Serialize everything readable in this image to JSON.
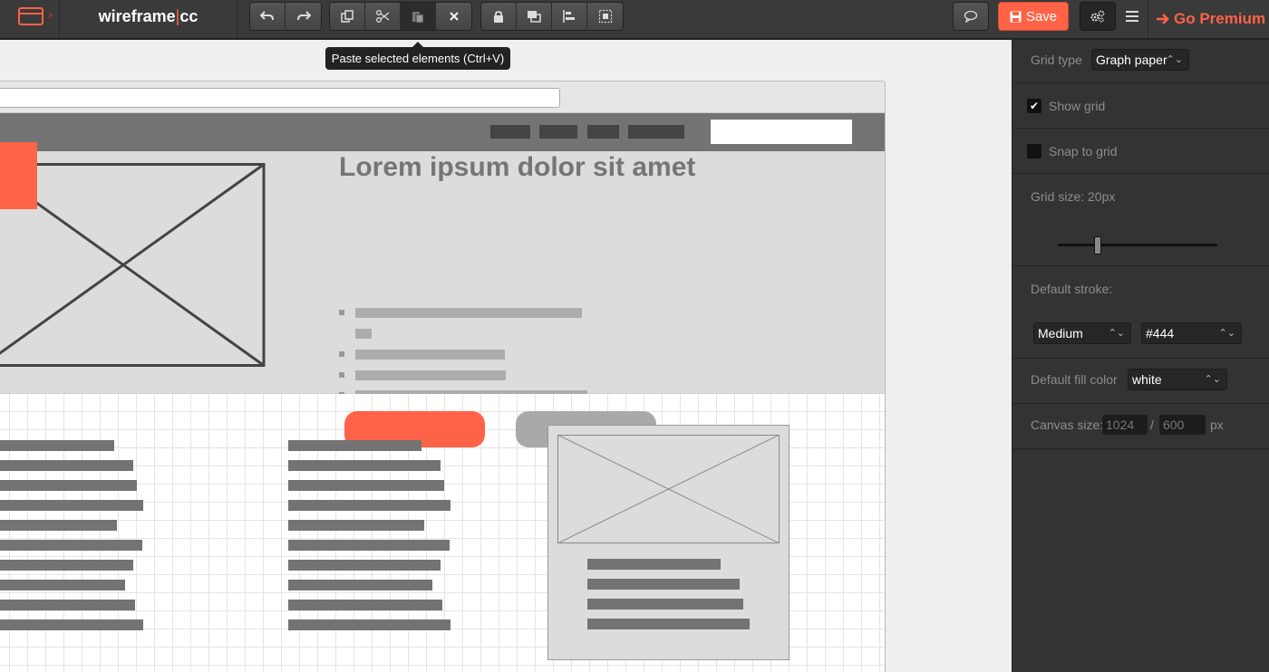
{
  "app": {
    "brand_left": "wireframe",
    "brand_sep": "|",
    "brand_right": "cc",
    "accent": "#ff6347"
  },
  "toolbar": {
    "history": [
      {
        "name": "undo-icon"
      },
      {
        "name": "redo-icon"
      }
    ],
    "clipboard": [
      {
        "name": "copy-icon"
      },
      {
        "name": "cut-icon"
      },
      {
        "name": "paste-icon",
        "active": true
      },
      {
        "name": "delete-icon"
      }
    ],
    "arrange": [
      {
        "name": "lock-icon"
      },
      {
        "name": "bring-to-front-icon"
      },
      {
        "name": "align-icon"
      },
      {
        "name": "group-icon"
      }
    ],
    "save_label": "Save",
    "premium_label": "Go Premium"
  },
  "tooltip": {
    "text": "Paste selected elements (Ctrl+V)"
  },
  "canvas": {
    "hero_title": "Lorem ipsum dolor sit amet"
  },
  "panel": {
    "grid_type_label": "Grid type",
    "grid_type_value": "Graph paper",
    "show_grid_label": "Show grid",
    "show_grid_checked": true,
    "snap_label": "Snap to grid",
    "snap_checked": false,
    "grid_size_label": "Grid size: 20px",
    "grid_size_value": 20,
    "default_stroke_label": "Default stroke:",
    "stroke_width_value": "Medium",
    "stroke_color_value": "#444",
    "fill_label": "Default fill color",
    "fill_value": "white",
    "canvas_size_label": "Canvas size:",
    "canvas_width": "1024",
    "canvas_sep": "/",
    "canvas_height": "600",
    "canvas_unit": "px"
  }
}
